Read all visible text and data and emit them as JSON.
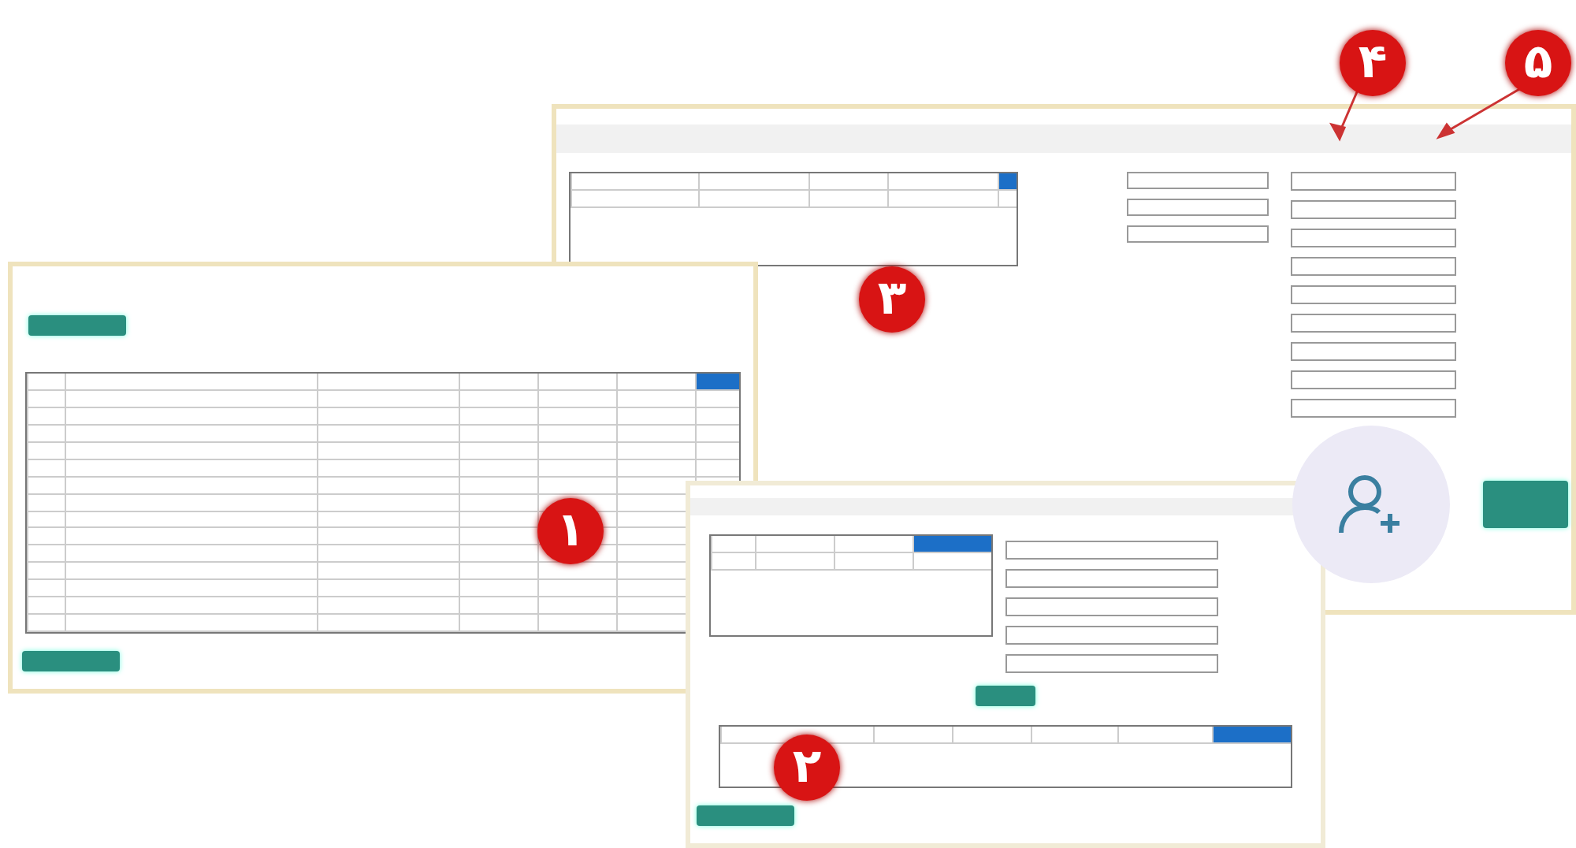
{
  "main_window": {
    "grid_rows": [
      {
        "selected": true
      },
      {
        "selected": false
      }
    ]
  },
  "list_window": {
    "grid_rows": [
      {
        "selected": true
      },
      {
        "selected": false
      },
      {
        "selected": false
      },
      {
        "selected": false
      },
      {
        "selected": false
      },
      {
        "selected": false
      },
      {
        "selected": false
      }
    ]
  },
  "detail_window": {
    "grid_rows": [
      {
        "selected": true
      },
      {
        "selected": false
      }
    ],
    "items_rows": [
      {
        "selected": true
      }
    ]
  },
  "markers": [
    {
      "label": "۱"
    },
    {
      "label": "۲"
    },
    {
      "label": "۳"
    },
    {
      "label": "۴"
    },
    {
      "label": "۵"
    }
  ]
}
